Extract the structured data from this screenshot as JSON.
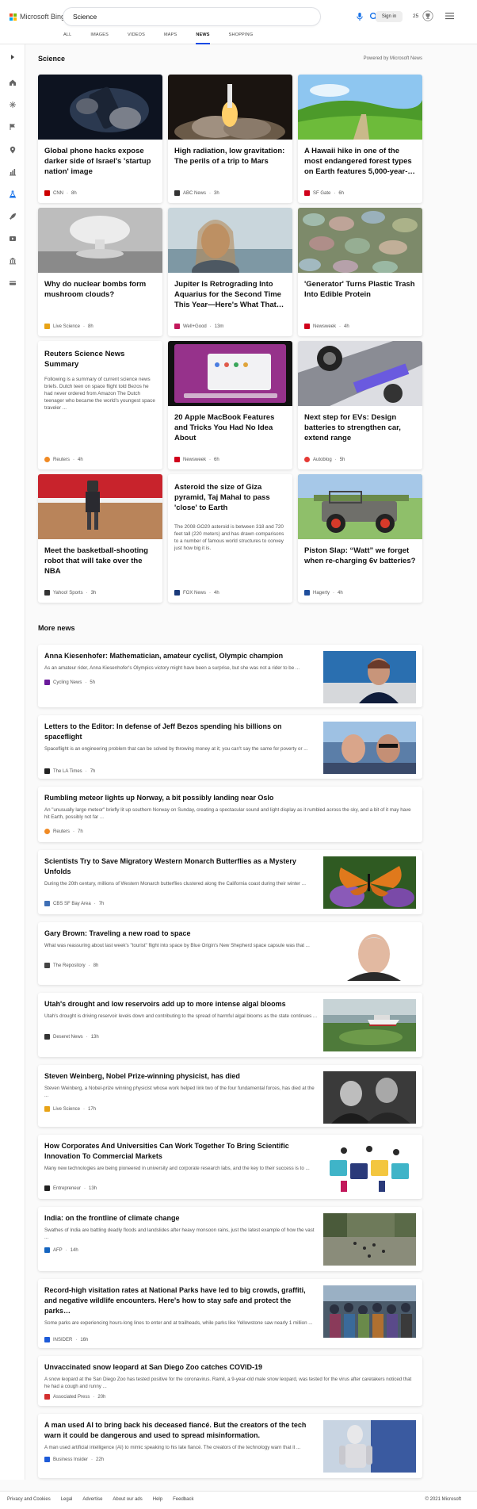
{
  "header": {
    "logo_text": "Microsoft Bing",
    "search_value": "Science",
    "signin_label": "Sign in",
    "rewards_count": "25",
    "tabs": [
      {
        "label": "ALL"
      },
      {
        "label": "IMAGES"
      },
      {
        "label": "VIDEOS"
      },
      {
        "label": "MAPS"
      },
      {
        "label": "NEWS",
        "active": true
      },
      {
        "label": "SHOPPING"
      }
    ]
  },
  "section": {
    "title": "Science",
    "powered_by": "Powered by Microsoft News"
  },
  "cards": [
    {
      "title": "Global phone hacks expose darker side of Israel's 'startup nation' image",
      "source": "CNN",
      "time": "8h",
      "logo_color": "#cc0000"
    },
    {
      "title": "High radiation, low gravitation: The perils of a trip to Mars",
      "source": "ABC News",
      "time": "3h",
      "logo_color": "#333333"
    },
    {
      "title": "A Hawaii hike in one of the most endangered forest types on Earth features 5,000-year-…",
      "source": "SF Gate",
      "time": "6h",
      "logo_color": "#d0021b"
    },
    {
      "title": "Why do nuclear bombs form mushroom clouds?",
      "source": "Live Science",
      "time": "8h",
      "logo_color": "#e8a317"
    },
    {
      "title": "Jupiter Is Retrograding Into Aquarius for the Second Time This Year—Here's What That…",
      "source": "Well+Good",
      "time": "13m",
      "logo_color": "#c2185b"
    },
    {
      "title": "'Generator' Turns Plastic Trash Into Edible Protein",
      "source": "Newsweek",
      "time": "4h",
      "logo_color": "#d0021b"
    },
    {
      "title": "Reuters Science News Summary",
      "summary": "Following is a summary of current science news briefs. Dutch teen on space flight told Bezos he had never ordered from Amazon The Dutch teenager who became the world's youngest space traveler ...",
      "source": "Reuters",
      "time": "4h",
      "logo_color": "#f08a24"
    },
    {
      "title": "20 Apple MacBook Features and Tricks You Had No Idea About",
      "source": "Newsweek",
      "time": "6h",
      "logo_color": "#d0021b"
    },
    {
      "title": "Next step for EVs: Design batteries to strengthen car, extend range",
      "source": "Autoblog",
      "time": "5h",
      "logo_color": "#e53935"
    },
    {
      "title": "Meet the basketball-shooting robot that will take over the NBA",
      "source": "Yahoo! Sports",
      "time": "3h",
      "logo_color": "#333333"
    },
    {
      "title": "Asteroid the size of Giza pyramid, Taj Mahal to pass 'close' to Earth",
      "summary": "The 2008 GO20 asteroid is between 318 and 720 feet tall (220 meters) and has drawn comparisons to a number of famous world structures to convey just how big it is.",
      "source": "FOX News",
      "time": "4h",
      "logo_color": "#1a3a7a"
    },
    {
      "title": "Piston Slap: “Watt” we forget when re-charging 6v batteries?",
      "source": "Hagerty",
      "time": "4h",
      "logo_color": "#1f4e9c"
    }
  ],
  "more_news": {
    "title": "More news",
    "items": [
      {
        "title": "Anna Kiesenhofer: Mathematician, amateur cyclist, Olympic champion",
        "snippet": "As an amateur rider, Anna Kiesenhofer's Olympics victory might have been a surprise, but she was not a rider to be ...",
        "source": "Cycling News",
        "time": "5h",
        "logo_color": "#6a1b9a"
      },
      {
        "title": "Letters to the Editor: In defense of Jeff Bezos spending his billions on spaceflight",
        "snippet": "Spaceflight is an engineering problem that can be solved by throwing money at it; you can't say the same for poverty or ...",
        "source": "The LA Times",
        "time": "7h",
        "logo_color": "#222222"
      },
      {
        "title": "Rumbling meteor lights up Norway, a bit possibly landing near Oslo",
        "snippet": "An \"unusually large meteor\" briefly lit up southern Norway on Sunday, creating a spectacular sound and light display as it rumbled across the sky, and a bit of it may have hit Earth, possibly not far ...",
        "source": "Reuters",
        "time": "7h",
        "logo_color": "#f08a24"
      },
      {
        "title": "Scientists Try to Save Migratory Western Monarch Butterflies as a Mystery Unfolds",
        "snippet": "During the 20th century, millions of Western Monarch butterflies clustered along the California coast during their winter ...",
        "source": "CBS SF Bay Area",
        "time": "7h",
        "logo_color": "#3f6fb5"
      },
      {
        "title": "Gary Brown: Traveling a new road to space",
        "snippet": "What was reassuring about last week's \"tourist\" flight into space by Blue Origin's New Shepherd space capsule was that ...",
        "source": "The Repository",
        "time": "8h",
        "logo_color": "#444444"
      },
      {
        "title": "Utah's drought and low reservoirs add up to more intense algal blooms",
        "snippet": "Utah's drought is driving reservoir levels down and contributing to the spread of harmful algal blooms as the state continues ...",
        "source": "Deseret News",
        "time": "13h",
        "logo_color": "#333333"
      },
      {
        "title": "Steven Weinberg, Nobel Prize-winning physicist, has died",
        "snippet": "Steven Weinberg, a Nobel-prize winning physicist whose work helped link two of the four fundamental forces, has died at the ...",
        "source": "Live Science",
        "time": "17h",
        "logo_color": "#e8a317"
      },
      {
        "title": "How Corporates And Universities Can Work Together To Bring Scientific Innovation To Commercial Markets",
        "snippet": "Many new technologies are being pioneered in university and corporate research labs, and the key to their success is to ...",
        "source": "Entrepreneur",
        "time": "13h",
        "logo_color": "#222222"
      },
      {
        "title": "India: on the frontline of climate change",
        "snippet": "Swathes of India are battling deadly floods and landslides after heavy monsoon rains, just the latest example of how the vast ...",
        "source": "AFP",
        "time": "14h",
        "logo_color": "#1565c0"
      },
      {
        "title": "Record-high visitation rates at National Parks have led to big crowds, graffiti, and negative wildlife encounters. Here's how to stay safe and protect the parks…",
        "snippet": "Some parks are experiencing hours-long lines to enter and at trailheads, while parks like Yellowstone saw nearly 1 million ...",
        "source": "INSIDER",
        "time": "16h",
        "logo_color": "#1e5bd8"
      },
      {
        "title": "Unvaccinated snow leopard at San Diego Zoo catches COVID-19",
        "snippet": "A snow leopard at the San Diego Zoo has tested positive for the coronavirus. Ramil, a 9-year-old male snow leopard, was tested for the virus after caretakers noticed that he had a cough and runny ...",
        "source": "Associated Press",
        "time": "20h",
        "logo_color": "#d32f2f"
      },
      {
        "title": "A man used AI to bring back his deceased fiancé. But the creators of the tech warn it could be dangerous and used to spread misinformation.",
        "snippet": "A man used artificial intelligence (AI) to mimic speaking to his late fiancé. The creators of the technology warn that it ...",
        "source": "Business Insider",
        "time": "22h",
        "logo_color": "#1e5bd8"
      }
    ]
  },
  "footer": {
    "links": [
      "Privacy and Cookies",
      "Legal",
      "Advertise",
      "About our ads",
      "Help",
      "Feedback"
    ],
    "copyright": "© 2021 Microsoft"
  }
}
